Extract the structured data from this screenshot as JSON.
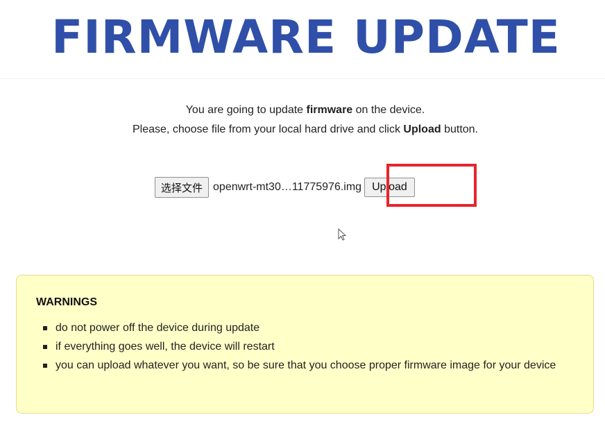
{
  "header": {
    "title": "FIRMWARE UPDATE"
  },
  "intro": {
    "line1_before": "You are going to update ",
    "line1_bold": "firmware",
    "line1_after": " on the device.",
    "line2_before": "Please, choose file from your local hard drive and click ",
    "line2_bold": "Upload",
    "line2_after": " button."
  },
  "upload_form": {
    "choose_file_label": "选择文件",
    "selected_file": "openwrt-mt30…11775976.img",
    "upload_label": "Upload"
  },
  "warnings": {
    "title": "WARNINGS",
    "items": [
      "do not power off the device during update",
      "if everything goes well, the device will restart",
      "you can upload whatever you want, so be sure that you choose proper firmware image for your device"
    ]
  },
  "colors": {
    "title": "#2f4fa8",
    "highlight": "#e8242c",
    "warning_bg": "#ffffc8"
  }
}
